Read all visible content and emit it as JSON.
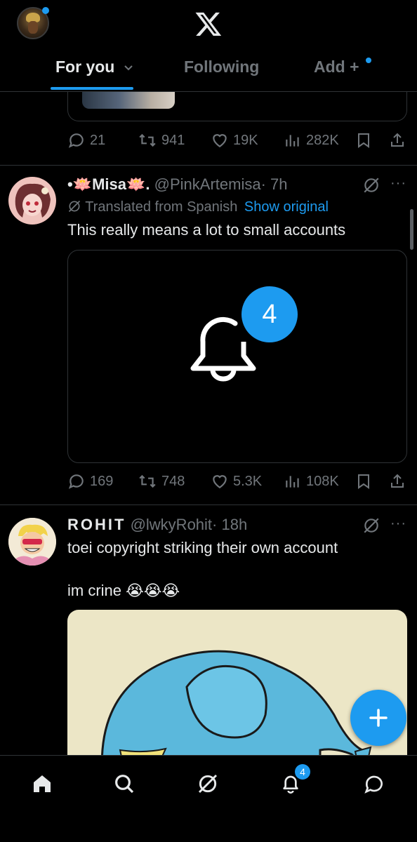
{
  "header": {
    "tabs": [
      {
        "label": "For you",
        "active": true
      },
      {
        "label": "Following",
        "active": false
      },
      {
        "label": "Add +",
        "active": false
      }
    ]
  },
  "post0": {
    "stats": {
      "replies": "21",
      "reposts": "941",
      "likes": "19K",
      "views": "282K"
    }
  },
  "post1": {
    "name": "•🪷Misa🪷.",
    "handle": "@PinkArtemisa",
    "time": "· 7h",
    "translated_label": "Translated from Spanish",
    "show_original": "Show original",
    "text": "This really means a lot to small accounts",
    "media_badge": "4",
    "stats": {
      "replies": "169",
      "reposts": "748",
      "likes": "5.3K",
      "views": "108K"
    }
  },
  "post2": {
    "name": "ROHIT",
    "handle": "@lwkyRohit",
    "time": "· 18h",
    "text_line1": "toei copyright striking their own account",
    "text_line2": "im crine 😭😭😭"
  },
  "bottom_nav": {
    "notification_count": "4"
  },
  "colors": {
    "accent": "#1d9bf0",
    "background": "#000000",
    "muted": "#71767b",
    "text": "#e7e9ea",
    "divider": "#2f3336"
  },
  "icons": [
    "x-logo-icon",
    "chevron-down-icon",
    "reply-icon",
    "repost-icon",
    "like-icon",
    "views-icon",
    "bookmark-icon",
    "share-icon",
    "grok-icon",
    "more-icon",
    "bell-icon",
    "plus-icon",
    "home-icon",
    "search-icon",
    "notifications-icon",
    "messages-icon"
  ]
}
